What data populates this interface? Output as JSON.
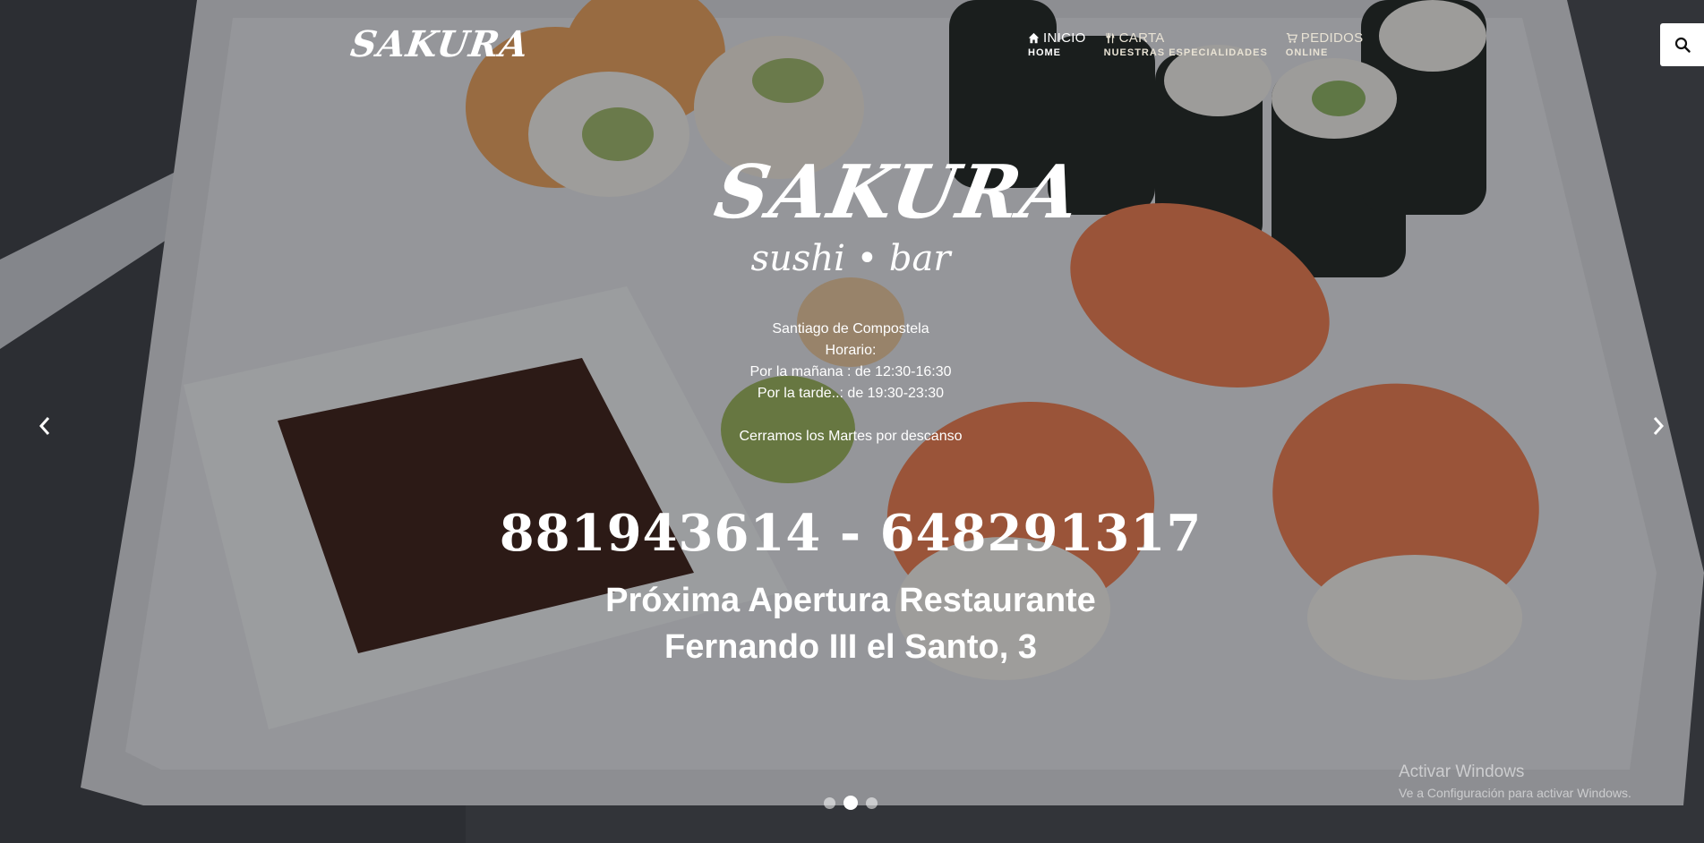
{
  "header": {
    "logo": "SAKURA",
    "nav": [
      {
        "label": "INICIO",
        "sub": "HOME",
        "icon": "home-icon"
      },
      {
        "label": "CARTA",
        "sub": "NUESTRAS ESPECIALIDADES",
        "icon": "utensils-icon"
      },
      {
        "label": "PEDIDOS",
        "sub": "ONLINE",
        "icon": "cart-icon"
      }
    ],
    "search_icon": "search-icon"
  },
  "hero": {
    "brand": "SAKURA",
    "tagline": "sushi • bar",
    "city": "Santiago de Compostela",
    "hours_label": "Horario:",
    "morning": "Por la mañana : de 12:30-16:30",
    "evening": "Por la tarde..: de 19:30-23:30",
    "closed": "Cerramos los Martes por descanso",
    "phones": "881943614 - 648291317",
    "opening_line1": "Próxima Apertura Restaurante",
    "opening_line2": "Fernando III el Santo, 3"
  },
  "carousel": {
    "prev_icon": "chevron-left-icon",
    "next_icon": "chevron-right-icon",
    "slides": 3,
    "active_slide": 2
  },
  "watermark": {
    "title": "Activar Windows",
    "subtitle": "Ve a Configuración para activar Windows."
  },
  "colors": {
    "overlay": "#14161a",
    "text": "#ffffff",
    "nav_muted": "#e8e2d4"
  }
}
